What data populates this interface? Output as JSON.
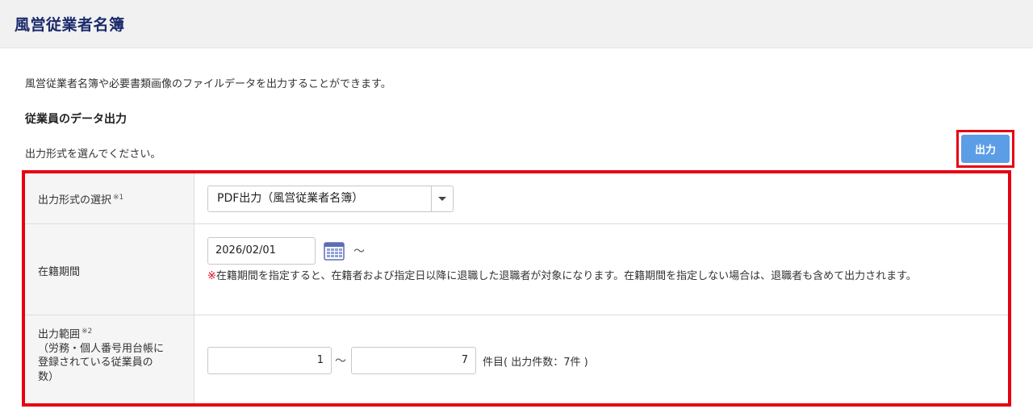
{
  "header": {
    "title": "風営従業者名簿"
  },
  "description": "風営従業者名簿や必要書類画像のファイルデータを出力することができます。",
  "section_title": "従業員のデータ出力",
  "instruction": "出力形式を選んでください。",
  "output_button": {
    "label": "出力",
    "color": "#5b9ee6"
  },
  "highlight_color": "#e60012",
  "form": {
    "output_format": {
      "label": "出力形式の選択",
      "note_ref": "※1",
      "selected": "PDF出力（風営従業者名簿）"
    },
    "enrollment_period": {
      "label": "在籍期間",
      "date_value": "2026/02/01",
      "tilde": "～",
      "note_mark": "※",
      "note_text": "在籍期間を指定すると、在籍者および指定日以降に退職した退職者が対象になります。在籍期間を指定しない場合は、退職者も含めて出力されます。"
    },
    "output_range": {
      "label_main": "出力範囲",
      "note_ref": "※2",
      "label_line2": "（労務・個人番号用台帳に",
      "label_line3": "登録されている従業員の",
      "label_line4": "数）",
      "from_value": "1",
      "tilde": "～",
      "to_value": "7",
      "suffix": "件目( 出力件数：7件 )"
    }
  }
}
